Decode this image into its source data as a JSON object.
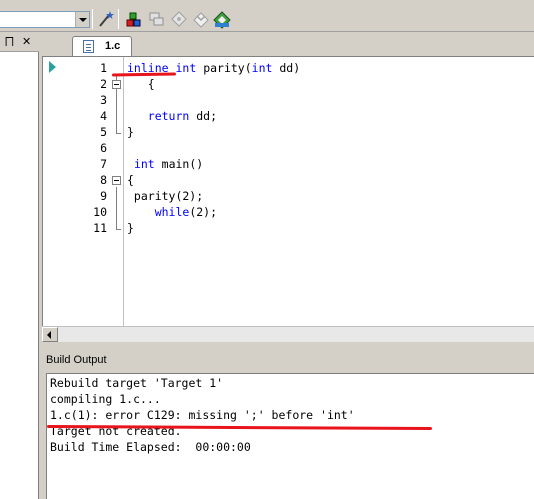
{
  "toolbar": {
    "target_combo_value": "",
    "buttons": [
      "magic-wand-icon",
      "translate-icon",
      "build-icon",
      "rebuild-icon",
      "download-icon",
      "options-icon"
    ]
  },
  "left_pane": {
    "pin_glyph": "⨅",
    "close_glyph": "✕"
  },
  "editor": {
    "tab_label": "1.c",
    "lines": [
      {
        "num": "1",
        "tokens": [
          {
            "t": "inline",
            "k": true
          },
          {
            "t": " ",
            "k": false
          },
          {
            "t": "int",
            "k": true
          },
          {
            "t": " parity(",
            "k": false
          },
          {
            "t": "int",
            "k": true
          },
          {
            "t": " dd)",
            "k": false
          }
        ]
      },
      {
        "num": "2",
        "tokens": [
          {
            "t": "   {",
            "k": false
          }
        ]
      },
      {
        "num": "3",
        "tokens": [
          {
            "t": "",
            "k": false
          }
        ]
      },
      {
        "num": "4",
        "tokens": [
          {
            "t": "   ",
            "k": false
          },
          {
            "t": "return",
            "k": true
          },
          {
            "t": " dd;",
            "k": false
          }
        ]
      },
      {
        "num": "5",
        "tokens": [
          {
            "t": "}",
            "k": false
          }
        ]
      },
      {
        "num": "6",
        "tokens": [
          {
            "t": "",
            "k": false
          }
        ]
      },
      {
        "num": "7",
        "tokens": [
          {
            "t": " ",
            "k": false
          },
          {
            "t": "int",
            "k": true
          },
          {
            "t": " main()",
            "k": false
          }
        ]
      },
      {
        "num": "8",
        "tokens": [
          {
            "t": "{",
            "k": false
          }
        ]
      },
      {
        "num": "9",
        "tokens": [
          {
            "t": " parity(2);",
            "k": false
          }
        ]
      },
      {
        "num": "10",
        "tokens": [
          {
            "t": "    ",
            "k": false
          },
          {
            "t": "while",
            "k": true
          },
          {
            "t": "(2);",
            "k": false
          }
        ]
      },
      {
        "num": "11",
        "tokens": [
          {
            "t": "}",
            "k": false
          }
        ]
      }
    ]
  },
  "build_output": {
    "title": "Build Output",
    "lines": [
      "Rebuild target 'Target 1'",
      "compiling 1.c...",
      "1.c(1): error C129: missing ';' before 'int'",
      "Target not created.",
      "Build Time Elapsed:  00:00:00"
    ]
  },
  "colors": {
    "keyword": "#0000ff",
    "markup_red": "#e8141c",
    "chrome": "#d4d0c8"
  }
}
